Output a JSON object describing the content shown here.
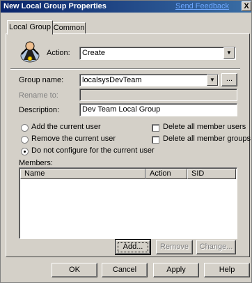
{
  "window": {
    "title": "New Local Group Properties",
    "feedback_link": "Send Feedback",
    "close_glyph": "X"
  },
  "tabs": [
    {
      "label": "Local Group"
    },
    {
      "label": "Common"
    }
  ],
  "action": {
    "label": "Action:",
    "value": "Create"
  },
  "group_name": {
    "label": "Group name:",
    "value": "localsysDevTeam",
    "browse_label": "..."
  },
  "rename_to": {
    "label": "Rename to:",
    "value": ""
  },
  "description": {
    "label": "Description:",
    "value": "Dev Team Local Group"
  },
  "radios": [
    {
      "label": "Add the current user",
      "checked": false
    },
    {
      "label": "Remove the current user",
      "checked": false
    },
    {
      "label": "Do not configure for the current user",
      "checked": true
    }
  ],
  "checkboxes": [
    {
      "label": "Delete all member users",
      "checked": false
    },
    {
      "label": "Delete all member groups",
      "checked": false
    }
  ],
  "members": {
    "label": "Members:",
    "columns": [
      "Name",
      "Action",
      "SID"
    ],
    "rows": []
  },
  "member_buttons": {
    "add": "Add...",
    "remove": "Remove",
    "change": "Change..."
  },
  "footer": {
    "ok": "OK",
    "cancel": "Cancel",
    "apply": "Apply",
    "help": "Help"
  }
}
